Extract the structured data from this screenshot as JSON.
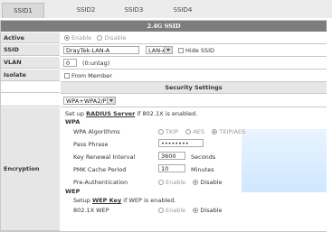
{
  "tabs": [
    "SSID1",
    "SSID2",
    "SSID3",
    "SSID4"
  ],
  "header": "2.4G SSID",
  "rows": {
    "active": {
      "label": "Active",
      "enable": "Enable",
      "disable": "Disable"
    },
    "ssid": {
      "label": "SSID",
      "value": "DrayTek-LAN-A",
      "lan_select": "LAN-A",
      "hide_label": "Hide SSID"
    },
    "vlan": {
      "label": "VLAN",
      "value": "0",
      "untag": "(0:untag)"
    },
    "isolate": {
      "label": "Isolate",
      "from_member": "From Member"
    }
  },
  "security": {
    "title": "Security Settings",
    "mode": "WPA+WPA2/PSK",
    "encryption_label": "Encryption",
    "setup_prefix": "Set up",
    "radius_link": "RADIUS Server",
    "setup_suffix": "if 802.1X is enabled.",
    "wpa_title": "WPA",
    "wpa_algorithms": "WPA Algorithms",
    "alg_tkip": "TKIP",
    "alg_aes": "AES",
    "alg_tkip_aes": "TKIP/AES",
    "pass_phrase_label": "Pass Phrase",
    "pass_phrase_value": "••••••••",
    "key_renewal_label": "Key Renewal Interval",
    "key_renewal_value": "3600",
    "seconds": "Seconds",
    "pmk_label": "PMK Cache Period",
    "pmk_value": "10",
    "minutes": "Minutes",
    "preauth_label": "Pre-Authentication",
    "enable": "Enable",
    "disable": "Disable",
    "wep_title": "WEP",
    "wep_setup_prefix": "Setup",
    "wep_link": "WEP Key",
    "wep_setup_suffix": "if WEP is enabled.",
    "wep_8021x_label": "802.1X WEP"
  }
}
